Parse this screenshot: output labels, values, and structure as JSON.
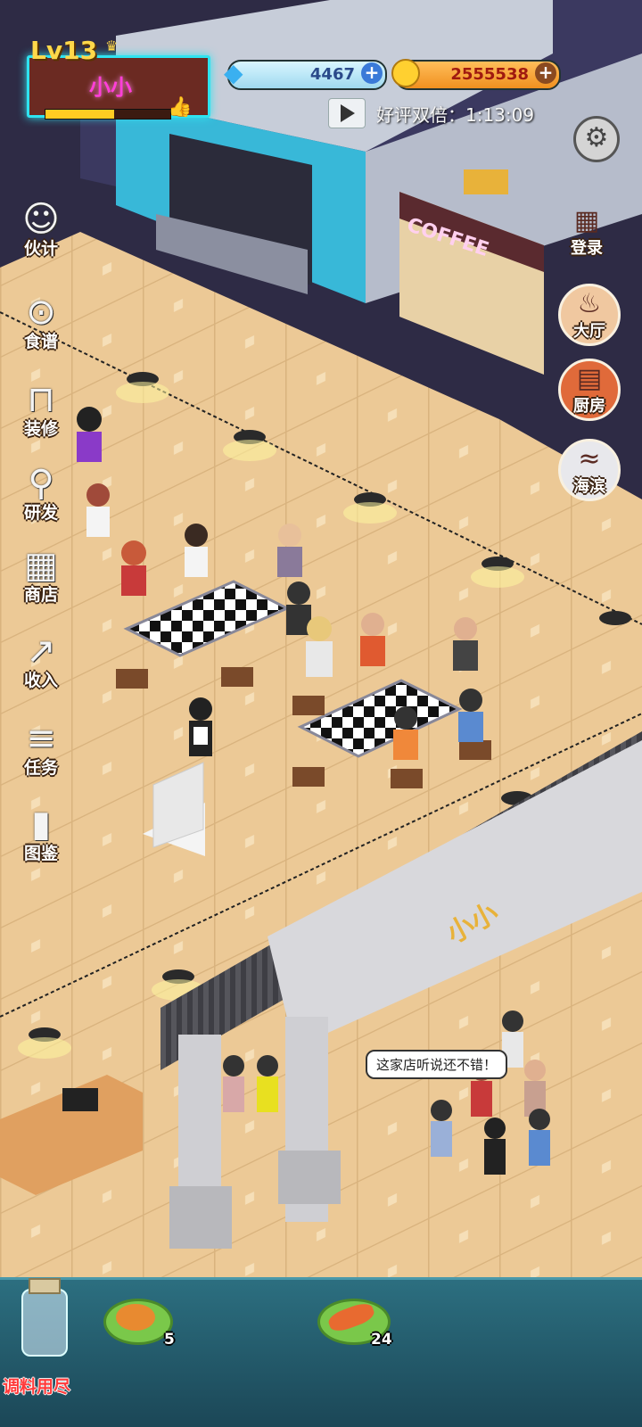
{
  "hud": {
    "level": "Lv13",
    "player_name": "小小",
    "exp_fraction": 0.55,
    "gems": "4467",
    "coins": "2555538",
    "double_reward_label": "好评双倍：1:13:09"
  },
  "storefront": {
    "sign": "COFFEE"
  },
  "left_menu": [
    {
      "id": "staff",
      "label": "伙计",
      "icon": "chef-hat-icon"
    },
    {
      "id": "recipes",
      "label": "食谱",
      "icon": "skewer-plate-icon"
    },
    {
      "id": "decorate",
      "label": "装修",
      "icon": "table-icon"
    },
    {
      "id": "research",
      "label": "研发",
      "icon": "magnifier-icon"
    },
    {
      "id": "shop",
      "label": "商店",
      "icon": "shop-awning-icon"
    },
    {
      "id": "income",
      "label": "收入",
      "icon": "rising-chart-icon"
    },
    {
      "id": "tasks",
      "label": "任务",
      "icon": "task-list-icon"
    },
    {
      "id": "codex",
      "label": "图鉴",
      "icon": "book-icon"
    }
  ],
  "right_menu": [
    {
      "id": "login",
      "label": "登录",
      "icon": "calendar-icon"
    },
    {
      "id": "hall",
      "label": "大厅",
      "icon": "dining-hall-icon"
    },
    {
      "id": "kitchen",
      "label": "厨房",
      "icon": "kitchen-icon"
    },
    {
      "id": "beach",
      "label": "海滨",
      "icon": "wave-icon"
    }
  ],
  "gate_sign": "小小",
  "customer_speech": "这家店听说还不错！",
  "bottom_tray": {
    "seasoning_label": "调料用尽",
    "foods": [
      {
        "name": "roast-chicken",
        "count": "5"
      },
      {
        "name": "grilled-fish",
        "count": "24"
      }
    ]
  },
  "colors": {
    "neon": "#2fe3f0",
    "name": "#ff3fd9",
    "gold": "#ffd84a",
    "warning": "#ff3a3a"
  }
}
